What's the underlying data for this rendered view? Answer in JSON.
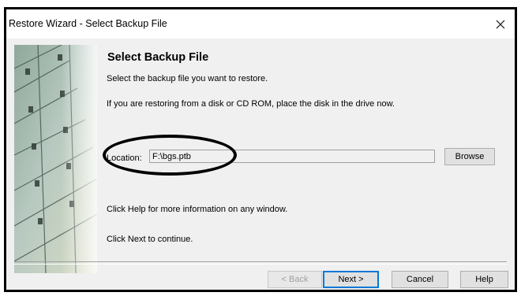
{
  "window": {
    "title": "Restore Wizard - Select Backup File",
    "close_icon": "close-icon"
  },
  "panel": {
    "heading": "Select Backup File",
    "instruction": "Select the backup file you want to restore.",
    "disk_note": "If you are restoring from a disk or CD ROM, place the disk in the drive now.",
    "help_note": "Click Help for more information on any window.",
    "next_note": "Click Next to continue."
  },
  "location": {
    "label": "Location:",
    "value": "F:\\bgs.ptb",
    "browse_label": "Browse"
  },
  "buttons": {
    "back": "< Back",
    "next": "Next >",
    "cancel": "Cancel",
    "help": "Help"
  },
  "colors": {
    "window_bg": "#f0f0f0",
    "accent": "#0078d7",
    "annotation": "#000000"
  }
}
